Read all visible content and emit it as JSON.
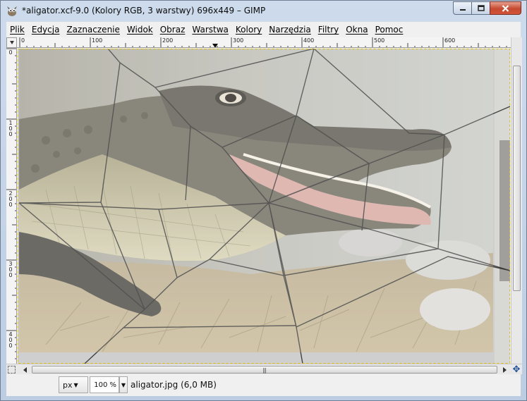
{
  "window": {
    "title": "*aligator.xcf-9.0 (Kolory RGB, 3 warstwy) 696x449 – GIMP"
  },
  "menubar": {
    "items": [
      {
        "label": "Plik"
      },
      {
        "label": "Edycja"
      },
      {
        "label": "Zaznaczenie"
      },
      {
        "label": "Widok"
      },
      {
        "label": "Obraz"
      },
      {
        "label": "Warstwa"
      },
      {
        "label": "Kolory"
      },
      {
        "label": "Narzędzia"
      },
      {
        "label": "Filtry"
      },
      {
        "label": "Okna"
      },
      {
        "label": "Pomoc"
      }
    ]
  },
  "rulers": {
    "horizontal_labels": [
      "0",
      "100",
      "200",
      "300",
      "400",
      "500",
      "600"
    ],
    "vertical_labels": [
      "0",
      "100",
      "200",
      "300",
      "400"
    ]
  },
  "statusbar": {
    "unit": "px",
    "zoom": "100 %",
    "info": "aligator.jpg (6,0 MB)"
  },
  "colors": {
    "window_frame": "#bccde2",
    "close_button": "#c64a30",
    "web_lines": "#2a2a2a"
  },
  "icons": [
    "gimp-app-icon",
    "minimize-icon",
    "maximize-icon",
    "close-icon",
    "navigate-icon",
    "quick-mask-icon"
  ]
}
